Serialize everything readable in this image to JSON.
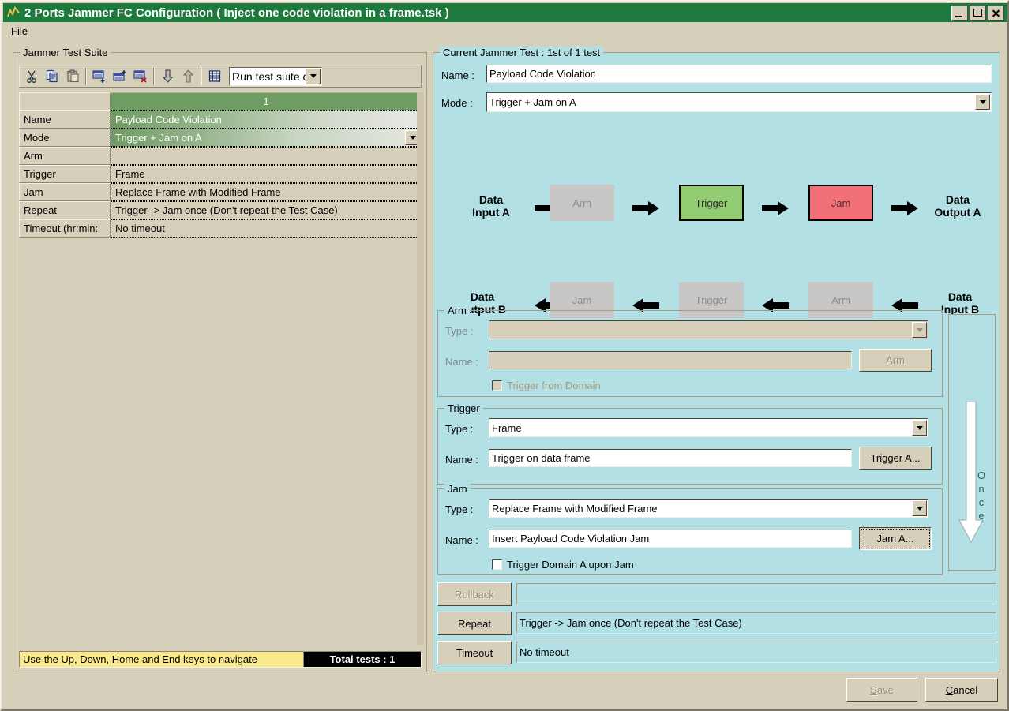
{
  "window": {
    "title": "2 Ports Jammer FC Configuration ( Inject one code violation in a frame.tsk )",
    "icon": "app-chart-icon",
    "minimize_label": "Minimize",
    "maximize_label": "Maximize",
    "close_label": "Close",
    "titlebar_color": "#1d7a3c"
  },
  "menu": {
    "items": [
      {
        "label": "File",
        "accel": "F"
      }
    ]
  },
  "left_panel": {
    "group_title": "Jammer Test Suite",
    "toolbar": {
      "buttons": [
        {
          "name": "cut-icon",
          "tooltip": "Cut"
        },
        {
          "name": "copy-icon",
          "tooltip": "Copy"
        },
        {
          "name": "paste-icon",
          "tooltip": "Paste"
        },
        {
          "name": "insert-test-icon",
          "tooltip": "Insert test"
        },
        {
          "name": "add-test-icon",
          "tooltip": "Add test"
        },
        {
          "name": "delete-test-icon",
          "tooltip": "Delete test"
        },
        {
          "name": "move-down-icon",
          "tooltip": "Move down"
        },
        {
          "name": "move-up-icon",
          "tooltip": "Move up"
        },
        {
          "name": "grid-view-icon",
          "tooltip": "Grid view"
        }
      ],
      "run_combo_value": "Run test suite o",
      "run_combo_options": [
        "Run test suite o"
      ]
    },
    "grid": {
      "column_header": "1",
      "rows": [
        {
          "label": "Name",
          "value": "Payload Code Violation",
          "state": "selected"
        },
        {
          "label": "Mode",
          "value": "Trigger + Jam on A",
          "state": "selected-dropdown"
        },
        {
          "label": "Arm",
          "value": "",
          "state": "normal"
        },
        {
          "label": "Trigger",
          "value": "Frame",
          "state": "normal"
        },
        {
          "label": "Jam",
          "value": "Replace Frame with Modified Frame",
          "state": "normal"
        },
        {
          "label": "Repeat",
          "value": "Trigger -> Jam once (Don't repeat the Test Case)",
          "state": "normal"
        },
        {
          "label": "Timeout (hr:min:",
          "value": "No timeout",
          "state": "normal"
        }
      ]
    },
    "status": {
      "hint": "Use the Up, Down, Home and End keys to navigate",
      "total": "Total tests : 1",
      "hint_bg": "#f8e98c"
    }
  },
  "right_panel": {
    "group_title": "Current Jammer Test : 1st of 1 test",
    "name_label": "Name :",
    "name_value": "Payload Code Violation",
    "mode_label": "Mode :",
    "mode_value": "Trigger + Jam on A",
    "diagram": {
      "row_a": {
        "input_label": "Data\nInput A",
        "input_line1": "Data",
        "input_line2": "Input A",
        "output_line1": "Data",
        "output_line2": "Output A",
        "boxes": [
          {
            "label": "Arm",
            "style": "grey"
          },
          {
            "label": "Trigger",
            "style": "green"
          },
          {
            "label": "Jam",
            "style": "red"
          }
        ],
        "direction": "right"
      },
      "row_b": {
        "output_line1": "Data",
        "output_line2": "Output B",
        "input_line1": "Data",
        "input_line2": "Input B",
        "boxes": [
          {
            "label": "Jam",
            "style": "grey"
          },
          {
            "label": "Trigger",
            "style": "grey"
          },
          {
            "label": "Arm",
            "style": "grey"
          }
        ],
        "direction": "left"
      },
      "colors": {
        "green": "#92cc72",
        "red": "#f27077",
        "grey": "#c9c6c6",
        "background": "#b3e0e5"
      }
    },
    "arm_group": {
      "title": "Arm",
      "type_label": "Type :",
      "type_value": "",
      "name_label": "Name :",
      "name_value": "",
      "button_label": "Arm",
      "checkbox_label": "Trigger from Domain",
      "checkbox_checked": false,
      "enabled": false
    },
    "trigger_group": {
      "title": "Trigger",
      "type_label": "Type :",
      "type_value": "Frame",
      "name_label": "Name :",
      "name_value": "Trigger on data frame",
      "button_label": "Trigger A...",
      "enabled": true
    },
    "jam_group": {
      "title": "Jam",
      "type_label": "Type :",
      "type_value": "Replace Frame with Modified Frame",
      "name_label": "Name :",
      "name_value": "Insert Payload Code Violation Jam",
      "button_label": "Jam A...",
      "button_focused": true,
      "checkbox_label": "Trigger Domain A upon Jam",
      "checkbox_checked": false,
      "enabled": true
    },
    "once_panel": {
      "label": "Once",
      "arrow": "down-arrow-icon"
    },
    "bottom_rows": [
      {
        "button": "Rollback",
        "enabled": false,
        "value": ""
      },
      {
        "button": "Repeat",
        "enabled": true,
        "value": "Trigger -> Jam once (Don't repeat the Test Case)"
      },
      {
        "button": "Timeout",
        "enabled": true,
        "value": "No timeout"
      }
    ]
  },
  "footer": {
    "save_label": "Save",
    "save_accel": "S",
    "save_enabled": false,
    "cancel_label": "Cancel",
    "cancel_accel": "C",
    "cancel_enabled": true
  }
}
